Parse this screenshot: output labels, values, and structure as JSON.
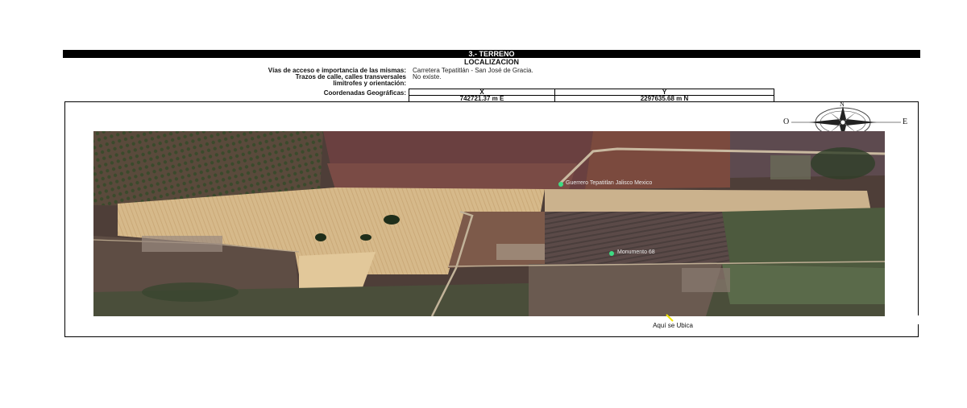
{
  "section": {
    "title": "3.- TERRENO",
    "subtitle": "LOCALIZACION"
  },
  "fields": [
    {
      "label": "Vías de acceso e importancia de las mismas:",
      "value": "Carretera Tepatitlán - San José de Gracia."
    },
    {
      "label": "Trazos de calle, calles transversales limítrofes y orientación:",
      "value": "No existe."
    }
  ],
  "coordinates": {
    "label": "Coordenadas  Geográficas:",
    "x_header": "X",
    "y_header": "Y",
    "x_value": "742721.37 m E",
    "y_value": "2297635.68 m N"
  },
  "compass": {
    "north": "N",
    "west": "O",
    "east": "E"
  },
  "map": {
    "place_label": "Guerrero Tepatitlan Jalisco Mexico",
    "point_label": "Monumento 68",
    "caption": "Aquí se Ubica",
    "marker_color": "#3ddc84",
    "pointer_color": "#f2e600"
  }
}
